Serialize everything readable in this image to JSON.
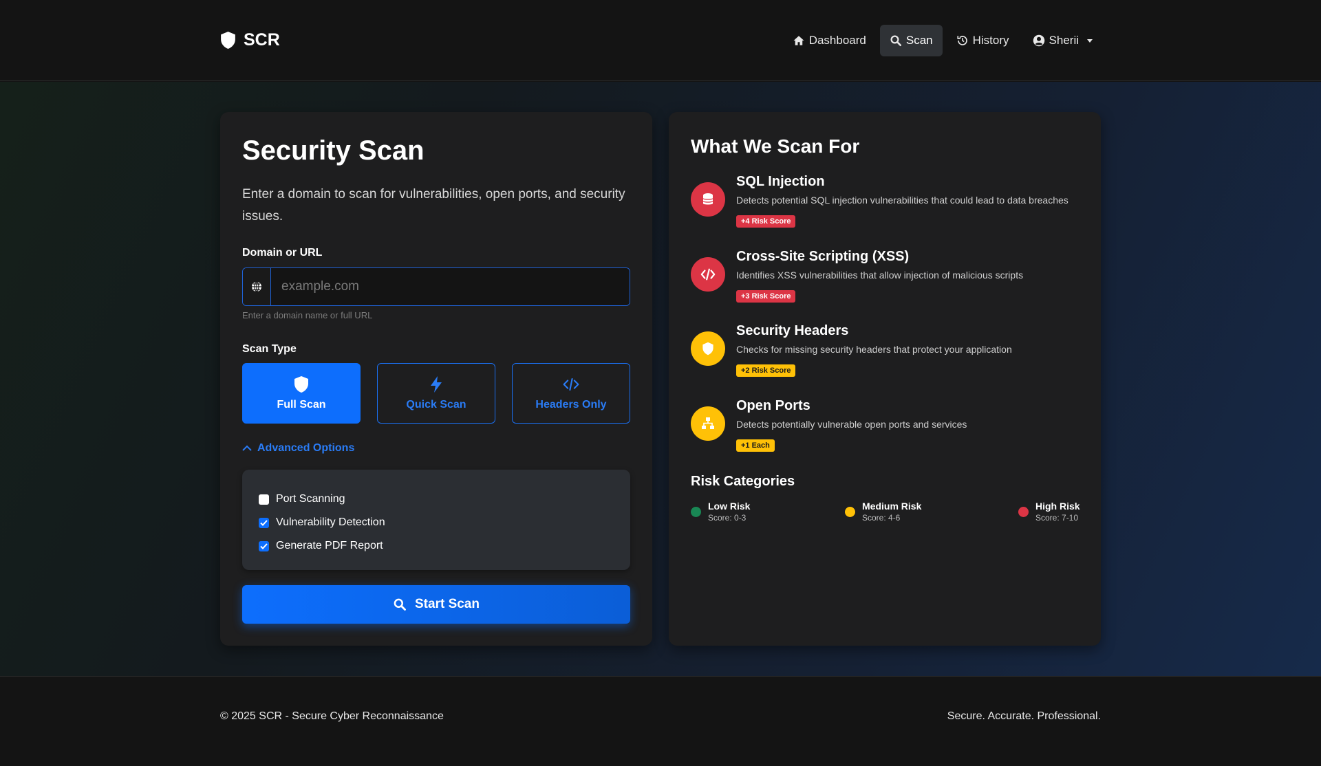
{
  "nav": {
    "brand": "SCR",
    "links": [
      {
        "label": "Dashboard",
        "icon": "home-icon"
      },
      {
        "label": "Scan",
        "icon": "search-icon",
        "active": true
      },
      {
        "label": "History",
        "icon": "history-icon"
      }
    ],
    "user": "Sherii"
  },
  "scan": {
    "title": "Security Scan",
    "description": "Enter a domain to scan for vulnerabilities, open ports, and security issues.",
    "domain_label": "Domain or URL",
    "domain_placeholder": "example.com",
    "domain_value": "",
    "domain_help": "Enter a domain name or full URL",
    "type_label": "Scan Type",
    "types": [
      {
        "label": "Full Scan",
        "icon": "shield-icon",
        "active": true
      },
      {
        "label": "Quick Scan",
        "icon": "bolt-icon",
        "active": false
      },
      {
        "label": "Headers Only",
        "icon": "code-icon",
        "active": false
      }
    ],
    "advanced_label": "Advanced Options",
    "options": [
      {
        "label": "Port Scanning",
        "checked": false
      },
      {
        "label": "Vulnerability Detection",
        "checked": true
      },
      {
        "label": "Generate PDF Report",
        "checked": true
      }
    ],
    "start_label": "Start Scan"
  },
  "what_we_scan": {
    "title": "What We Scan For",
    "items": [
      {
        "title": "SQL Injection",
        "desc": "Detects potential SQL injection vulnerabilities that could lead to data breaches",
        "badge": "+4 Risk Score",
        "color": "red",
        "icon": "database-icon"
      },
      {
        "title": "Cross-Site Scripting (XSS)",
        "desc": "Identifies XSS vulnerabilities that allow injection of malicious scripts",
        "badge": "+3 Risk Score",
        "color": "red",
        "icon": "code-icon"
      },
      {
        "title": "Security Headers",
        "desc": "Checks for missing security headers that protect your application",
        "badge": "+2 Risk Score",
        "color": "yellow",
        "icon": "shield-icon"
      },
      {
        "title": "Open Ports",
        "desc": "Detects potentially vulnerable open ports and services",
        "badge": "+1 Each",
        "color": "yellow",
        "icon": "network-icon"
      }
    ],
    "risk_title": "Risk Categories",
    "risk_categories": [
      {
        "name": "Low Risk",
        "score": "Score: 0-3",
        "color": "#198754"
      },
      {
        "name": "Medium Risk",
        "score": "Score: 4-6",
        "color": "#ffc107"
      },
      {
        "name": "High Risk",
        "score": "Score: 7-10",
        "color": "#dc3545"
      }
    ]
  },
  "footer": {
    "left": "© 2025 SCR - Secure Cyber Reconnaissance",
    "right": "Secure. Accurate. Professional."
  },
  "colors": {
    "accent": "#0d6efd",
    "danger": "#dc3545",
    "warning": "#ffc107",
    "success": "#198754"
  }
}
